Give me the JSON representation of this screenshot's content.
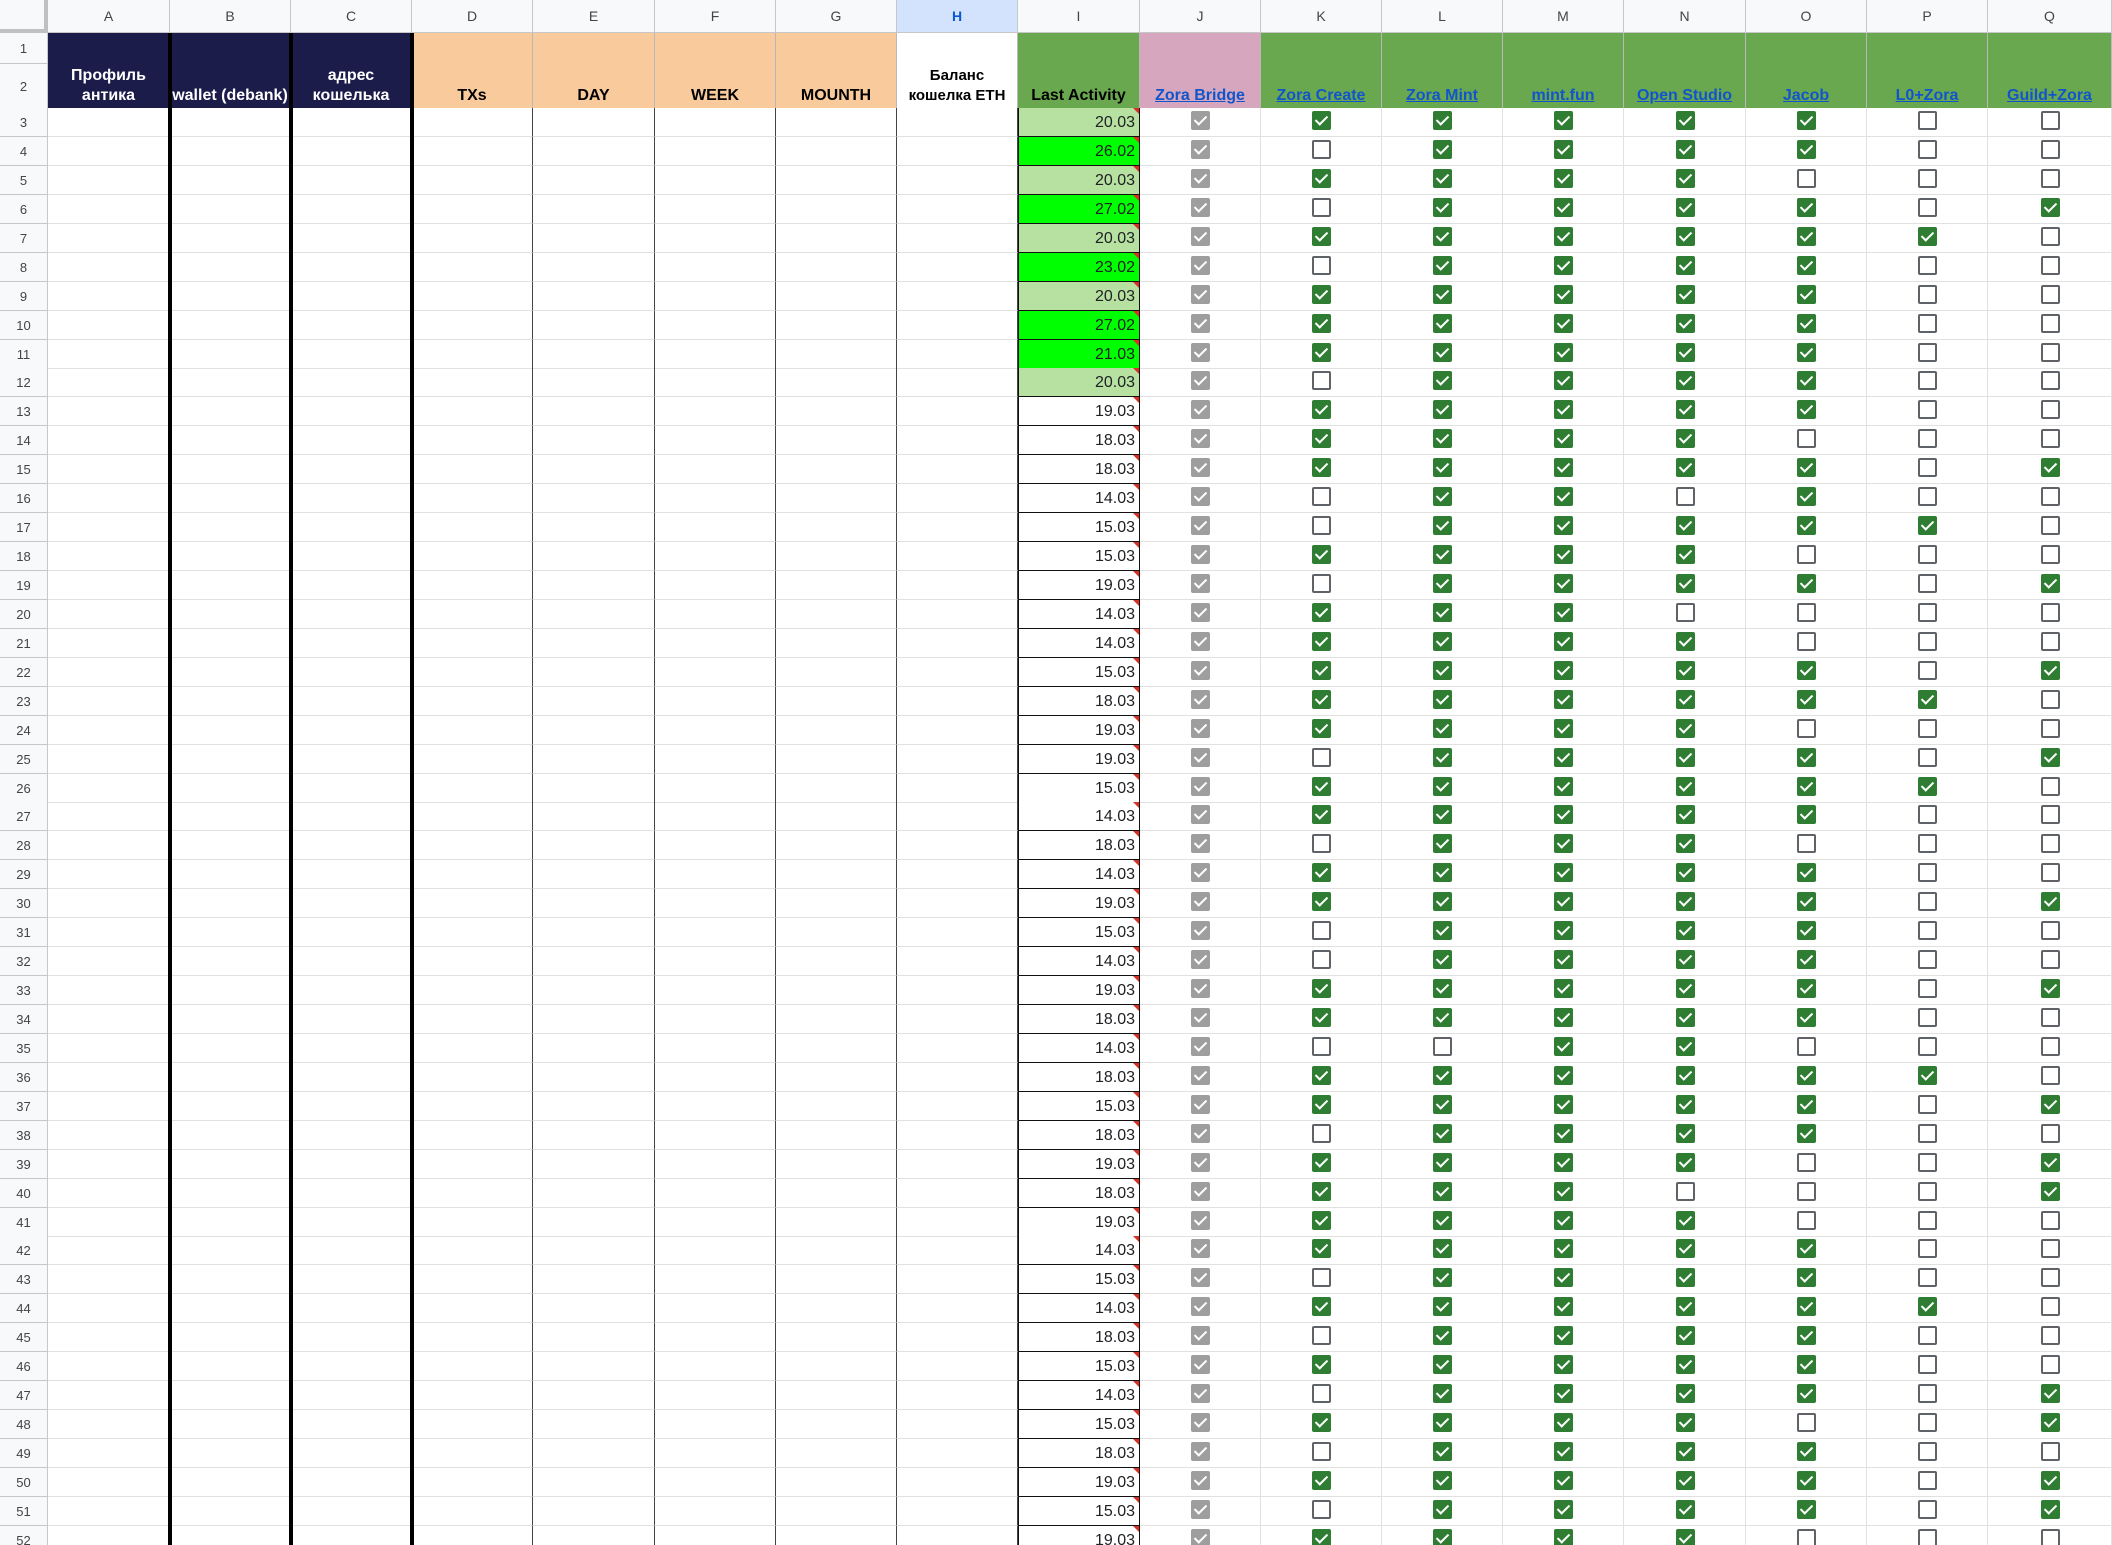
{
  "columns": [
    "A",
    "B",
    "C",
    "D",
    "E",
    "F",
    "G",
    "H",
    "I",
    "J",
    "K",
    "L",
    "M",
    "N",
    "O",
    "P",
    "Q"
  ],
  "selected_column": "H",
  "rows": [
    "1",
    "2",
    "3",
    "4",
    "5",
    "6",
    "7",
    "8",
    "9",
    "10",
    "11",
    "12",
    "13",
    "14",
    "15",
    "16",
    "17",
    "18",
    "19",
    "20",
    "21",
    "22",
    "23",
    "24",
    "25",
    "26",
    "27",
    "28",
    "29",
    "30",
    "31",
    "32",
    "33",
    "34",
    "35",
    "36",
    "37",
    "38",
    "39",
    "40",
    "41",
    "42",
    "43",
    "44",
    "45",
    "46",
    "47",
    "48",
    "49",
    "50",
    "51",
    "52"
  ],
  "headers": {
    "A": "Профиль антика",
    "B": "wallet (debank)",
    "C": "адрес кошелька",
    "D": "TXs",
    "E": "DAY",
    "F": "WEEK",
    "G": "MOUNTH",
    "H": "Баланс кошелка ETH",
    "I": "Last Activity",
    "J": "Zora Bridge",
    "K": "Zora Create",
    "L": "Zora Mint",
    "M": "mint.fun",
    "N": "Open Studio",
    "O": "Jacob",
    "P": "L0+Zora",
    "Q": "Guild+Zora"
  },
  "colors": {
    "header_dark": "#1c1c4b",
    "header_orange": "#f9cb9c",
    "header_green": "#6aa84f",
    "header_pink": "#d5a6bd",
    "date_light_green": "#b7e1a1",
    "date_bright_green": "#00ff00",
    "checkbox_green": "#2e7d32",
    "checkbox_grey": "#9e9e9e"
  },
  "last_activity": [
    {
      "d": "20.03",
      "bg": "light"
    },
    {
      "d": "26.02",
      "bg": "bright"
    },
    {
      "d": "20.03",
      "bg": "light"
    },
    {
      "d": "27.02",
      "bg": "bright"
    },
    {
      "d": "20.03",
      "bg": "light"
    },
    {
      "d": "23.02",
      "bg": "bright"
    },
    {
      "d": "20.03",
      "bg": "light"
    },
    {
      "d": "27.02",
      "bg": "bright"
    },
    {
      "d": "21.03",
      "bg": "bright"
    },
    {
      "d": "20.03",
      "bg": "light"
    },
    {
      "d": "19.03"
    },
    {
      "d": "18.03"
    },
    {
      "d": "18.03"
    },
    {
      "d": "14.03"
    },
    {
      "d": "15.03"
    },
    {
      "d": "15.03"
    },
    {
      "d": "19.03"
    },
    {
      "d": "14.03"
    },
    {
      "d": "14.03"
    },
    {
      "d": "15.03"
    },
    {
      "d": "18.03"
    },
    {
      "d": "19.03"
    },
    {
      "d": "19.03"
    },
    {
      "d": "15.03"
    },
    {
      "d": "14.03"
    },
    {
      "d": "18.03"
    },
    {
      "d": "14.03"
    },
    {
      "d": "19.03"
    },
    {
      "d": "15.03"
    },
    {
      "d": "14.03"
    },
    {
      "d": "19.03"
    },
    {
      "d": "18.03"
    },
    {
      "d": "14.03"
    },
    {
      "d": "18.03"
    },
    {
      "d": "15.03"
    },
    {
      "d": "18.03"
    },
    {
      "d": "19.03"
    },
    {
      "d": "18.03"
    },
    {
      "d": "19.03"
    },
    {
      "d": "14.03"
    },
    {
      "d": "15.03"
    },
    {
      "d": "14.03"
    },
    {
      "d": "18.03"
    },
    {
      "d": "15.03"
    },
    {
      "d": "14.03"
    },
    {
      "d": "15.03"
    },
    {
      "d": "18.03"
    },
    {
      "d": "19.03"
    },
    {
      "d": "15.03"
    },
    {
      "d": "19.03"
    }
  ],
  "checkboxes": {
    "K": "1010101110111001011111011011001101101111010101010101",
    "L": "11111111111111111111111111111111011111111111111111",
    "M": "11111111111111111111111111111111111111111111111111",
    "N": "11111111111110111011111111111111111110111111111111",
    "O": "11011111111011101001101110111111011100011111101110",
    "P": "00001000000000100000100100000000010000000100000000",
    "Q": "00010000000010001001001000010010001011000000110110"
  }
}
